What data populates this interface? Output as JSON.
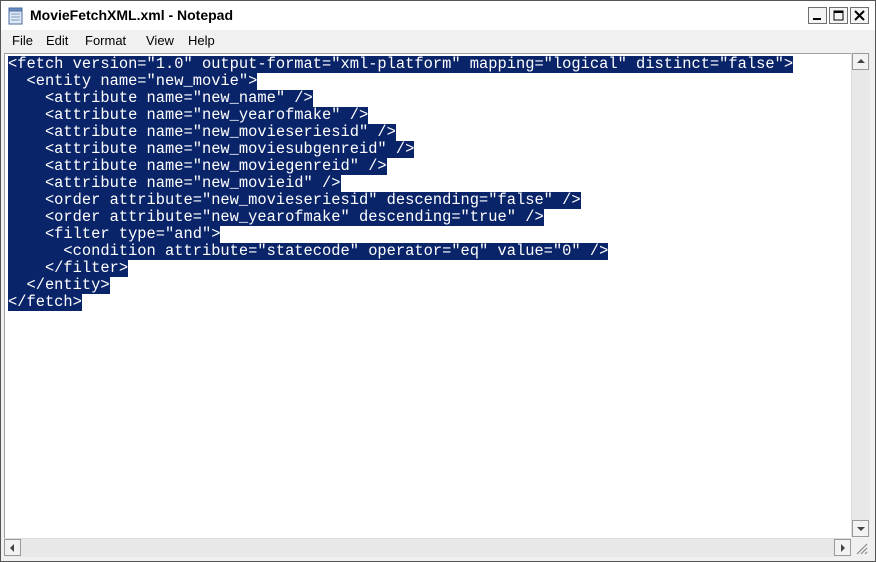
{
  "window": {
    "title": "MovieFetchXML.xml - Notepad",
    "icons": {
      "app": "notepad-icon",
      "minimize": "minimize-icon",
      "maximize": "maximize-icon",
      "close": "close-icon"
    }
  },
  "menu": {
    "items": [
      "File",
      "Edit",
      "Format",
      "View",
      "Help"
    ]
  },
  "editor": {
    "selection_color": "#0a246a",
    "lines": [
      "<fetch version=\"1.0\" output-format=\"xml-platform\" mapping=\"logical\" distinct=\"false\">",
      "  <entity name=\"new_movie\">",
      "    <attribute name=\"new_name\" />",
      "    <attribute name=\"new_yearofmake\" />",
      "    <attribute name=\"new_movieseriesid\" />",
      "    <attribute name=\"new_moviesubgenreid\" />",
      "    <attribute name=\"new_moviegenreid\" />",
      "    <attribute name=\"new_movieid\" />",
      "    <order attribute=\"new_movieseriesid\" descending=\"false\" />",
      "    <order attribute=\"new_yearofmake\" descending=\"true\" />",
      "    <filter type=\"and\">",
      "      <condition attribute=\"statecode\" operator=\"eq\" value=\"0\" />",
      "    </filter>",
      "  </entity>",
      "</fetch>"
    ]
  },
  "scrollbars": {
    "icons": {
      "up": "arrow-up-icon",
      "down": "arrow-down-icon",
      "left": "arrow-left-icon",
      "right": "arrow-right-icon",
      "grip": "resize-grip-icon"
    }
  }
}
